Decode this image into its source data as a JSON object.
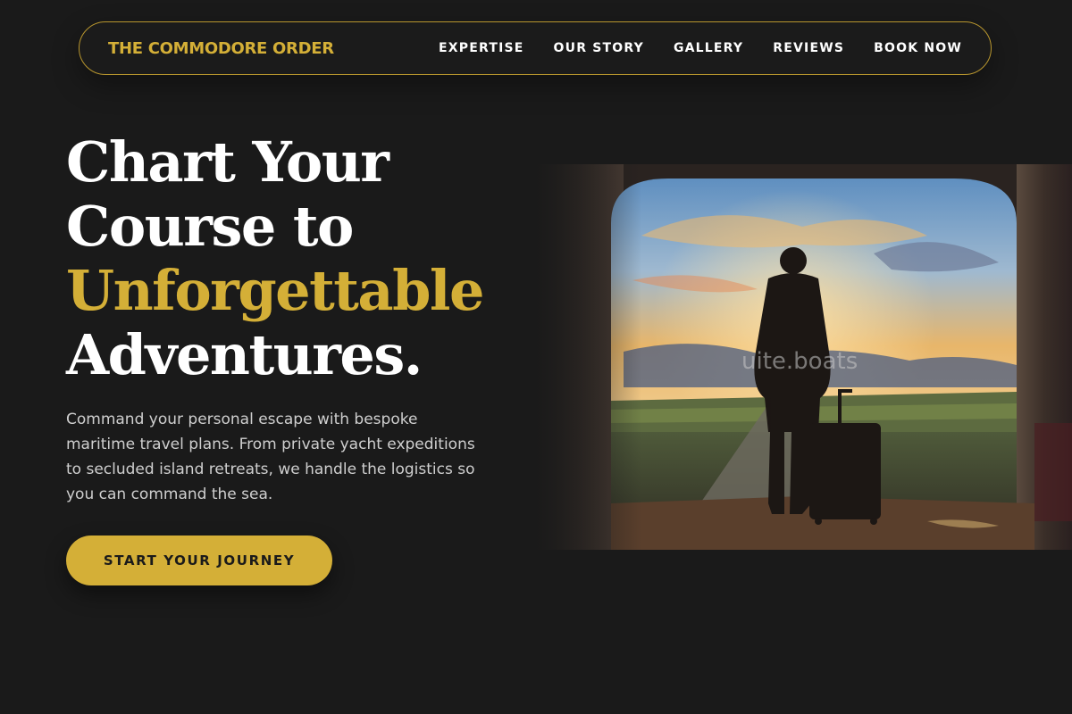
{
  "brand": {
    "name": "THE COMMODORE ORDER"
  },
  "nav": {
    "items": [
      {
        "label": "EXPERTISE"
      },
      {
        "label": "OUR STORY"
      },
      {
        "label": "GALLERY"
      },
      {
        "label": "REVIEWS"
      },
      {
        "label": "BOOK NOW"
      }
    ]
  },
  "hero": {
    "title_lines": [
      "Chart Your",
      "Course to",
      "Unforgettable",
      "Adventures."
    ],
    "description": "Command your personal escape with bespoke maritime travel plans. From private yacht expeditions to secluded island retreats, we handle the logistics so you can command the sea.",
    "cta_label": "START YOUR JOURNEY",
    "image_watermark": "uite.boats"
  },
  "colors": {
    "background": "#1a1a1a",
    "accent": "#d4af37",
    "text": "#ffffff",
    "muted_text": "#cfcfcf"
  },
  "icons": {
    "hero_image": "traveler-with-suitcase-under-arch-at-sunset"
  }
}
